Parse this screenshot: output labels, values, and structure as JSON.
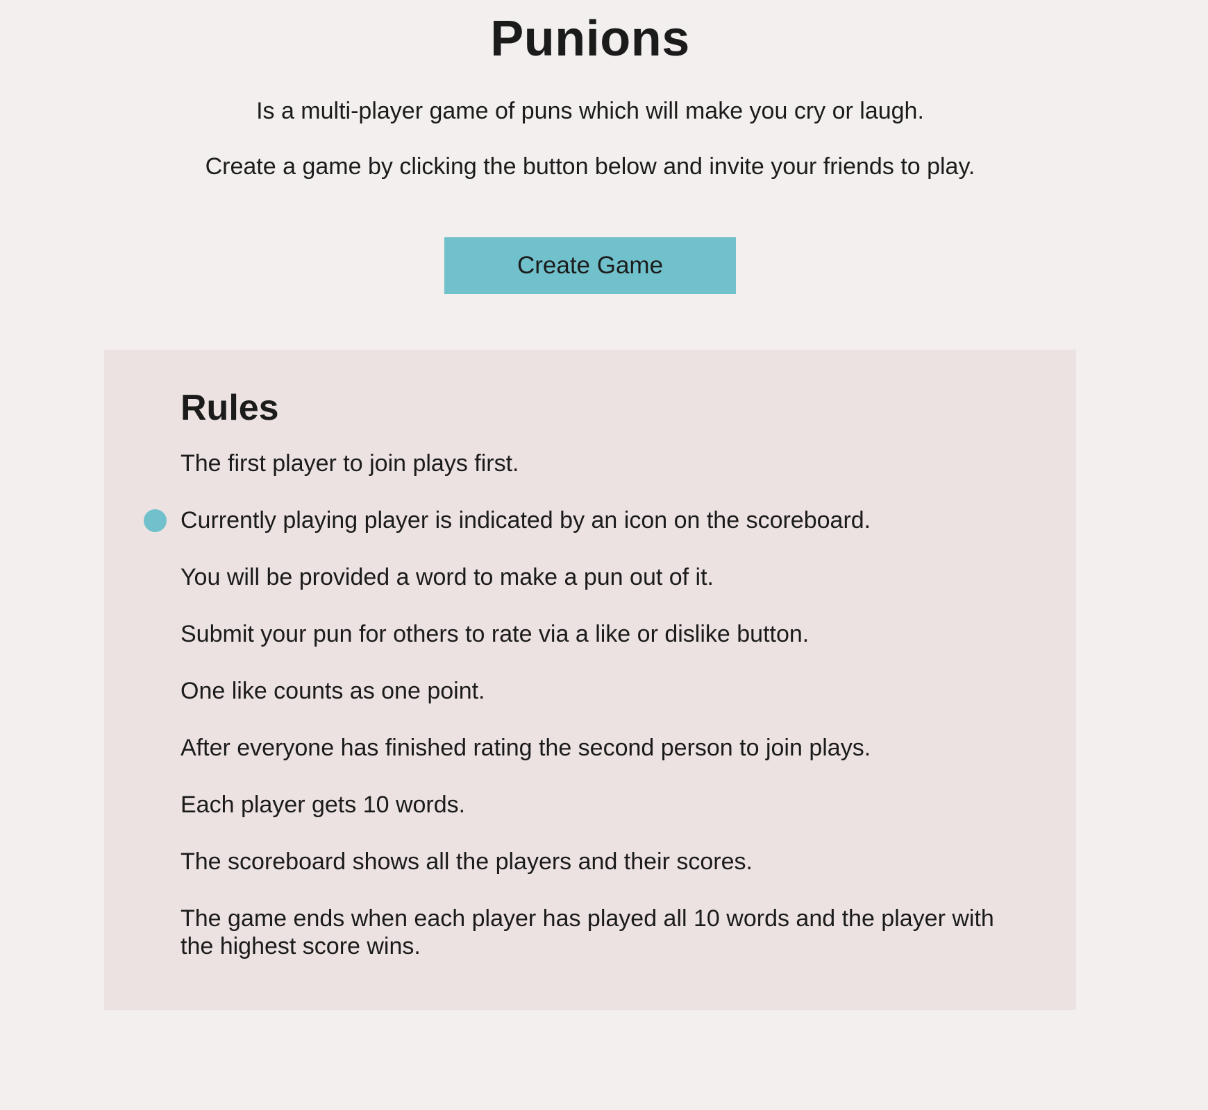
{
  "header": {
    "title": "Punions",
    "tagline": "Is a multi-player game of puns which will make you cry or laugh.",
    "instruction": "Create a game by clicking the button below and invite your friends to play."
  },
  "actions": {
    "create_game_label": "Create Game"
  },
  "rules": {
    "heading": "Rules",
    "items": [
      "The first player to join plays first.",
      "Currently playing player is indicated by an icon on the scoreboard.",
      "You will be provided a word to make a pun out of it.",
      "Submit your pun for others to rate via a like or dislike button.",
      "One like counts as one point.",
      "After everyone has finished rating the second person to join plays.",
      "Each player gets 10 words.",
      "The scoreboard shows all the players and their scores.",
      "The game ends when each player has played all 10 words and the player with the highest score wins."
    ],
    "indicator_icon": "circle-dot-icon"
  },
  "colors": {
    "page_background": "#f4efef",
    "panel_background": "#ece2e1",
    "accent": "#71c1cc",
    "text": "#1b1b1b"
  }
}
